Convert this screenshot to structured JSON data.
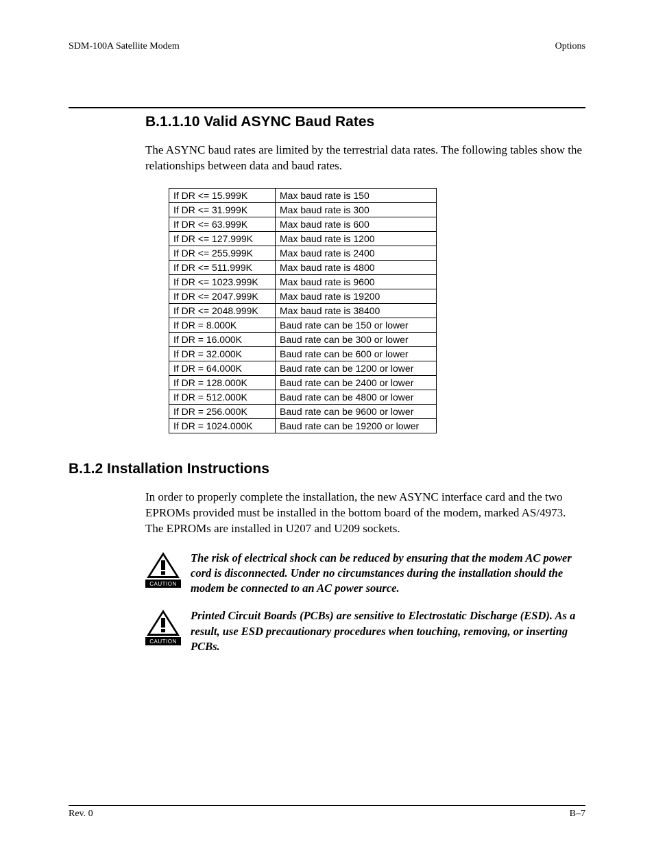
{
  "header": {
    "left": "SDM-100A Satellite Modem",
    "right": "Options"
  },
  "section1": {
    "heading": "B.1.1.10  Valid ASYNC Baud Rates",
    "para": "The ASYNC baud rates are limited by the terrestrial data rates. The following tables show the relationships between data and baud rates.",
    "rows": [
      {
        "c1": "If DR <= 15.999K",
        "c2": "Max baud rate is 150"
      },
      {
        "c1": "If DR <= 31.999K",
        "c2": "Max baud rate is 300"
      },
      {
        "c1": "If DR <= 63.999K",
        "c2": "Max baud rate is 600"
      },
      {
        "c1": "If DR <= 127.999K",
        "c2": "Max baud rate is 1200"
      },
      {
        "c1": "If DR <= 255.999K",
        "c2": "Max baud rate is 2400"
      },
      {
        "c1": "If DR <= 511.999K",
        "c2": "Max baud rate is 4800"
      },
      {
        "c1": "If DR <= 1023.999K",
        "c2": "Max baud rate is 9600"
      },
      {
        "c1": "If DR <= 2047.999K",
        "c2": "Max baud rate is 19200"
      },
      {
        "c1": "If DR <= 2048.999K",
        "c2": "Max baud rate is 38400"
      },
      {
        "c1": "If DR = 8.000K",
        "c2": "Baud rate can be 150 or lower"
      },
      {
        "c1": "If DR = 16.000K",
        "c2": "Baud rate can be 300 or lower"
      },
      {
        "c1": "If DR = 32.000K",
        "c2": "Baud rate can be 600 or lower"
      },
      {
        "c1": "If DR = 64.000K",
        "c2": "Baud rate can be 1200 or lower"
      },
      {
        "c1": "If DR = 128.000K",
        "c2": "Baud rate can be 2400 or lower"
      },
      {
        "c1": "If DR = 512.000K",
        "c2": "Baud rate can be 4800 or lower"
      },
      {
        "c1": "If DR = 256.000K",
        "c2": "Baud rate can be 9600 or lower"
      },
      {
        "c1": "If DR = 1024.000K",
        "c2": "Baud rate can be 19200 or lower"
      }
    ]
  },
  "section2": {
    "heading": "B.1.2  Installation Instructions",
    "para": "In order to properly complete the installation, the new ASYNC interface card and the two EPROMs provided must be installed in the bottom board of the modem, marked AS/4973. The EPROMs are installed in U207 and U209 sockets."
  },
  "cautions": [
    {
      "label": "CAUTION",
      "text": "The risk of electrical shock can be reduced by ensuring that the modem AC power cord is disconnected. Under no circumstances during the installation should the modem be connected to an AC power source."
    },
    {
      "label": "CAUTION",
      "text": "Printed Circuit Boards (PCBs) are sensitive to Electrostatic Discharge (ESD). As a result, use ESD precautionary procedures when touching, removing, or inserting PCBs."
    }
  ],
  "footer": {
    "left": "Rev. 0",
    "right": "B–7"
  }
}
